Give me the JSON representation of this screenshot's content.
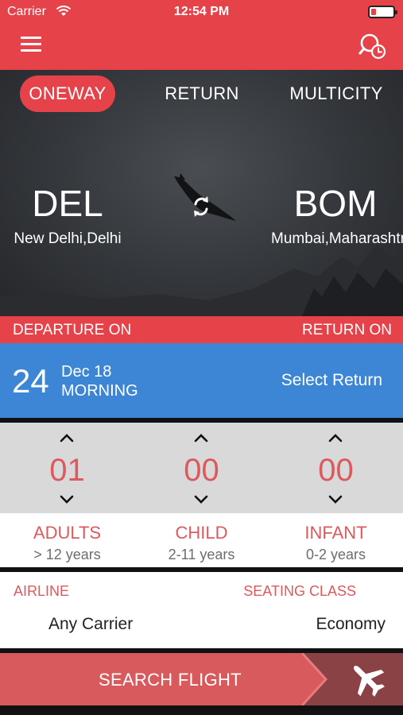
{
  "status_bar": {
    "carrier": "Carrier",
    "time": "12:54 PM"
  },
  "header": {
    "menu_icon": "hamburger-menu-icon",
    "history_icon": "search-history-icon"
  },
  "trip_tabs": {
    "oneway": "ONEWAY",
    "return": "RETURN",
    "multicity": "MULTICITY",
    "selected": "ONEWAY"
  },
  "route": {
    "from": {
      "code": "DEL",
      "name": "New Delhi,Delhi"
    },
    "to": {
      "code": "BOM",
      "name": "Mumbai,Maharashtra"
    }
  },
  "dates": {
    "departure_label": "DEPARTURE ON",
    "return_label": "RETURN ON",
    "day": "24",
    "month_year": "Dec 18",
    "time_slot": "MORNING",
    "select_return": "Select Return"
  },
  "passengers": {
    "adults": {
      "count": "01",
      "label": "ADULTS",
      "range": "> 12 years"
    },
    "child": {
      "count": "00",
      "label": "CHILD",
      "range": "2-11 years"
    },
    "infant": {
      "count": "00",
      "label": "INFANT",
      "range": "0-2 years"
    }
  },
  "preferences": {
    "airline_label": "AIRLINE",
    "airline_value": "Any Carrier",
    "class_label": "SEATING CLASS",
    "class_value": "Economy"
  },
  "search": {
    "label": "SEARCH FLIGHT"
  },
  "colors": {
    "brand_red": "#e5424a",
    "date_blue": "#3d86d6",
    "count_red": "#dc5a5e",
    "search_red": "#d85a5c"
  }
}
